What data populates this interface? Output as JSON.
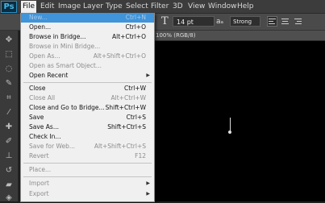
{
  "app": {
    "logo": "Ps"
  },
  "menubar": [
    "File",
    "Edit",
    "Image",
    "Layer",
    "Type",
    "Select",
    "Filter",
    "3D",
    "View",
    "Window",
    "Help"
  ],
  "options_bar": {
    "tool_icon": "text-tool-icon",
    "font_size": "14 pt",
    "aa_label": "aₐ",
    "antialias": "Strong",
    "align_icons": [
      "align-left-icon",
      "align-center-icon",
      "align-right-icon"
    ]
  },
  "document": {
    "tab_label": "100% (RGB/8)"
  },
  "file_menu": {
    "items": [
      {
        "label": "New...",
        "shortcut": "Ctrl+N",
        "state": "highlighted"
      },
      {
        "label": "Open...",
        "shortcut": "Ctrl+O"
      },
      {
        "label": "Browse in Bridge...",
        "shortcut": "Alt+Ctrl+O"
      },
      {
        "label": "Browse in Mini Bridge...",
        "shortcut": "",
        "state": "disabled"
      },
      {
        "label": "Open As...",
        "shortcut": "Alt+Shift+Ctrl+O",
        "state": "disabled"
      },
      {
        "label": "Open as Smart Object...",
        "shortcut": "",
        "state": "disabled"
      },
      {
        "label": "Open Recent",
        "shortcut": "",
        "submenu": true
      },
      {
        "label": "Close",
        "shortcut": "Ctrl+W"
      },
      {
        "label": "Close All",
        "shortcut": "Alt+Ctrl+W",
        "state": "disabled"
      },
      {
        "label": "Close and Go to Bridge...",
        "shortcut": "Shift+Ctrl+W"
      },
      {
        "label": "Save",
        "shortcut": "Ctrl+S"
      },
      {
        "label": "Save As...",
        "shortcut": "Shift+Ctrl+S"
      },
      {
        "label": "Check In...",
        "shortcut": ""
      },
      {
        "label": "Save for Web...",
        "shortcut": "Alt+Shift+Ctrl+S",
        "state": "disabled"
      },
      {
        "label": "Revert",
        "shortcut": "F12",
        "state": "disabled"
      },
      {
        "label": "Place...",
        "shortcut": "",
        "state": "disabled"
      },
      {
        "label": "Import",
        "shortcut": "",
        "submenu": true,
        "state": "disabled"
      },
      {
        "label": "Export",
        "shortcut": "",
        "submenu": true,
        "state": "disabled"
      }
    ]
  },
  "colors": {
    "highlight": "#3f94da",
    "menubar": "#3c3c3c",
    "canvas": "#000000"
  }
}
